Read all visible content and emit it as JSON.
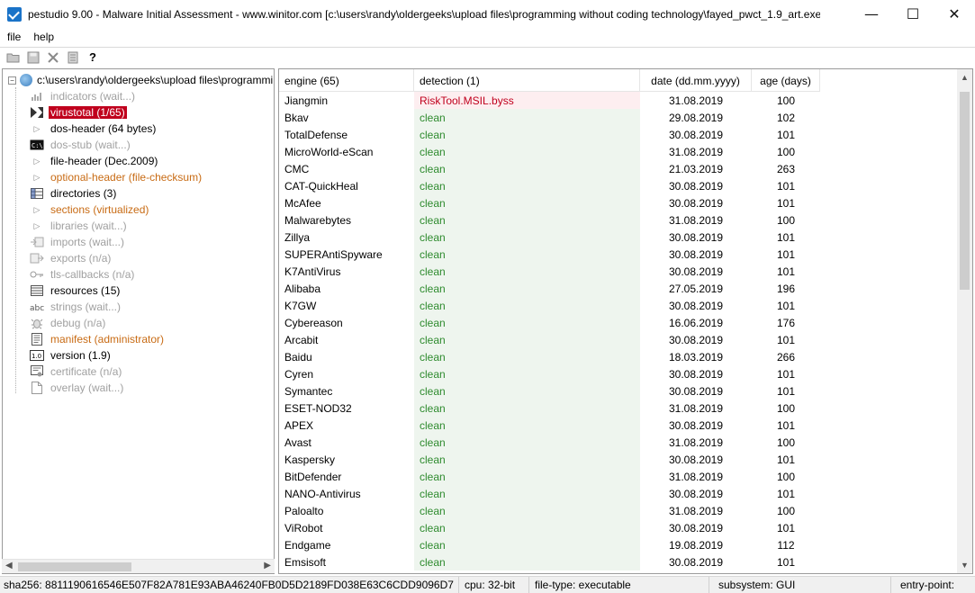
{
  "window": {
    "title": "pestudio 9.00 - Malware Initial Assessment - www.winitor.com [c:\\users\\randy\\oldergeeks\\upload files\\programming without coding technology\\fayed_pwct_1.9_art.exe]",
    "minimize": "—",
    "maximize": "☐",
    "close": "✕"
  },
  "menu": {
    "file": "file",
    "help": "help"
  },
  "toolbar": {
    "help_glyph": "?"
  },
  "tree": {
    "root": "c:\\users\\randy\\oldergeeks\\upload files\\programmi",
    "items": [
      {
        "label": "indicators (wait...)",
        "icon": "chart-icon",
        "state": "gray"
      },
      {
        "label": "virustotal (1/65)",
        "icon": "virustotal-icon",
        "state": "selected"
      },
      {
        "label": "dos-header (64 bytes)",
        "icon": "arrow",
        "state": "black"
      },
      {
        "label": "dos-stub (wait...)",
        "icon": "console-icon",
        "state": "gray"
      },
      {
        "label": "file-header (Dec.2009)",
        "icon": "arrow",
        "state": "black"
      },
      {
        "label": "optional-header (file-checksum)",
        "icon": "arrow",
        "state": "orange"
      },
      {
        "label": "directories (3)",
        "icon": "grid-icon",
        "state": "black"
      },
      {
        "label": "sections (virtualized)",
        "icon": "arrow",
        "state": "orange"
      },
      {
        "label": "libraries (wait...)",
        "icon": "arrow",
        "state": "gray"
      },
      {
        "label": "imports (wait...)",
        "icon": "imports-icon",
        "state": "gray"
      },
      {
        "label": "exports (n/a)",
        "icon": "exports-icon",
        "state": "gray"
      },
      {
        "label": "tls-callbacks (n/a)",
        "icon": "key-icon",
        "state": "gray"
      },
      {
        "label": "resources (15)",
        "icon": "resources-icon",
        "state": "black"
      },
      {
        "label": "strings (wait...)",
        "icon": "abc-icon",
        "state": "gray"
      },
      {
        "label": "debug (n/a)",
        "icon": "bug-icon",
        "state": "gray"
      },
      {
        "label": "manifest (administrator)",
        "icon": "manifest-icon",
        "state": "orange"
      },
      {
        "label": "version (1.9)",
        "icon": "version-icon",
        "state": "black"
      },
      {
        "label": "certificate (n/a)",
        "icon": "certificate-icon",
        "state": "gray"
      },
      {
        "label": "overlay (wait...)",
        "icon": "page-icon",
        "state": "gray"
      }
    ]
  },
  "table": {
    "columns": [
      "engine (65)",
      "detection (1)",
      "date (dd.mm.yyyy)",
      "age (days)"
    ],
    "rows": [
      {
        "engine": "Jiangmin",
        "detection": "RiskTool.MSIL.byss",
        "date": "31.08.2019",
        "age": "100"
      },
      {
        "engine": "Bkav",
        "detection": "clean",
        "date": "29.08.2019",
        "age": "102"
      },
      {
        "engine": "TotalDefense",
        "detection": "clean",
        "date": "30.08.2019",
        "age": "101"
      },
      {
        "engine": "MicroWorld-eScan",
        "detection": "clean",
        "date": "31.08.2019",
        "age": "100"
      },
      {
        "engine": "CMC",
        "detection": "clean",
        "date": "21.03.2019",
        "age": "263"
      },
      {
        "engine": "CAT-QuickHeal",
        "detection": "clean",
        "date": "30.08.2019",
        "age": "101"
      },
      {
        "engine": "McAfee",
        "detection": "clean",
        "date": "30.08.2019",
        "age": "101"
      },
      {
        "engine": "Malwarebytes",
        "detection": "clean",
        "date": "31.08.2019",
        "age": "100"
      },
      {
        "engine": "Zillya",
        "detection": "clean",
        "date": "30.08.2019",
        "age": "101"
      },
      {
        "engine": "SUPERAntiSpyware",
        "detection": "clean",
        "date": "30.08.2019",
        "age": "101"
      },
      {
        "engine": "K7AntiVirus",
        "detection": "clean",
        "date": "30.08.2019",
        "age": "101"
      },
      {
        "engine": "Alibaba",
        "detection": "clean",
        "date": "27.05.2019",
        "age": "196"
      },
      {
        "engine": "K7GW",
        "detection": "clean",
        "date": "30.08.2019",
        "age": "101"
      },
      {
        "engine": "Cybereason",
        "detection": "clean",
        "date": "16.06.2019",
        "age": "176"
      },
      {
        "engine": "Arcabit",
        "detection": "clean",
        "date": "30.08.2019",
        "age": "101"
      },
      {
        "engine": "Baidu",
        "detection": "clean",
        "date": "18.03.2019",
        "age": "266"
      },
      {
        "engine": "Cyren",
        "detection": "clean",
        "date": "30.08.2019",
        "age": "101"
      },
      {
        "engine": "Symantec",
        "detection": "clean",
        "date": "30.08.2019",
        "age": "101"
      },
      {
        "engine": "ESET-NOD32",
        "detection": "clean",
        "date": "31.08.2019",
        "age": "100"
      },
      {
        "engine": "APEX",
        "detection": "clean",
        "date": "30.08.2019",
        "age": "101"
      },
      {
        "engine": "Avast",
        "detection": "clean",
        "date": "31.08.2019",
        "age": "100"
      },
      {
        "engine": "Kaspersky",
        "detection": "clean",
        "date": "30.08.2019",
        "age": "101"
      },
      {
        "engine": "BitDefender",
        "detection": "clean",
        "date": "31.08.2019",
        "age": "100"
      },
      {
        "engine": "NANO-Antivirus",
        "detection": "clean",
        "date": "30.08.2019",
        "age": "101"
      },
      {
        "engine": "Paloalto",
        "detection": "clean",
        "date": "31.08.2019",
        "age": "100"
      },
      {
        "engine": "ViRobot",
        "detection": "clean",
        "date": "30.08.2019",
        "age": "101"
      },
      {
        "engine": "Endgame",
        "detection": "clean",
        "date": "19.08.2019",
        "age": "112"
      },
      {
        "engine": "Emsisoft",
        "detection": "clean",
        "date": "30.08.2019",
        "age": "101"
      }
    ]
  },
  "status": {
    "sha256": "sha256: 8811190616546E507F82A781E93ABA46240FB0D5D2189FD038E63C6CDD9096D7",
    "cpu": "cpu: 32-bit",
    "file_type": "file-type: executable",
    "subsystem": "subsystem: GUI",
    "entry_point": "entry-point:"
  },
  "colors": {
    "selected_bg": "#c0001d",
    "clean_text": "#2e8b2e",
    "flag_text": "#c0001d",
    "warn_text": "#c86b14",
    "muted_text": "#a0a0a0"
  }
}
